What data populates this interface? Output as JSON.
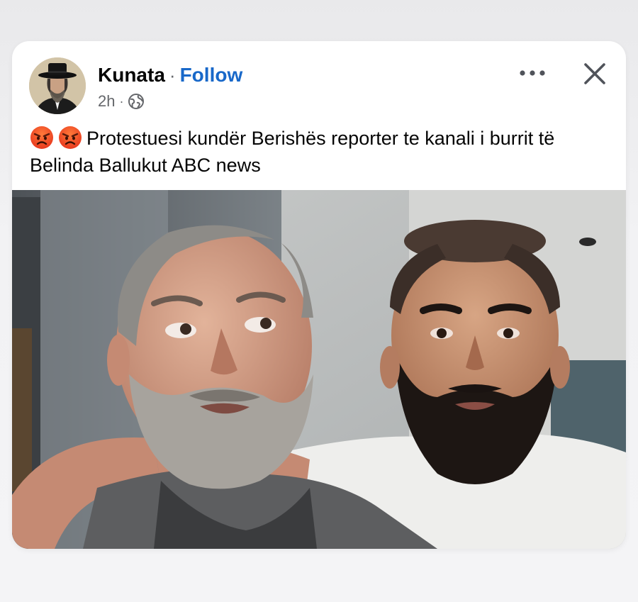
{
  "post": {
    "author": "Kunata",
    "separator": "·",
    "follow_label": "Follow",
    "time": "2h",
    "meta_separator": "·",
    "audience_icon": "globe-icon",
    "caption": "Protestuesi kundër Berishës reporter te kanali i burrit të Belinda Ballukut ABC news",
    "caption_emojis": [
      "angry-face-emoji",
      "angry-face-emoji"
    ],
    "more_icon": "more-options-icon",
    "close_icon": "close-icon"
  },
  "colors": {
    "follow": "#1868c9",
    "secondary_text": "#65676b",
    "card_background": "#ffffff"
  }
}
